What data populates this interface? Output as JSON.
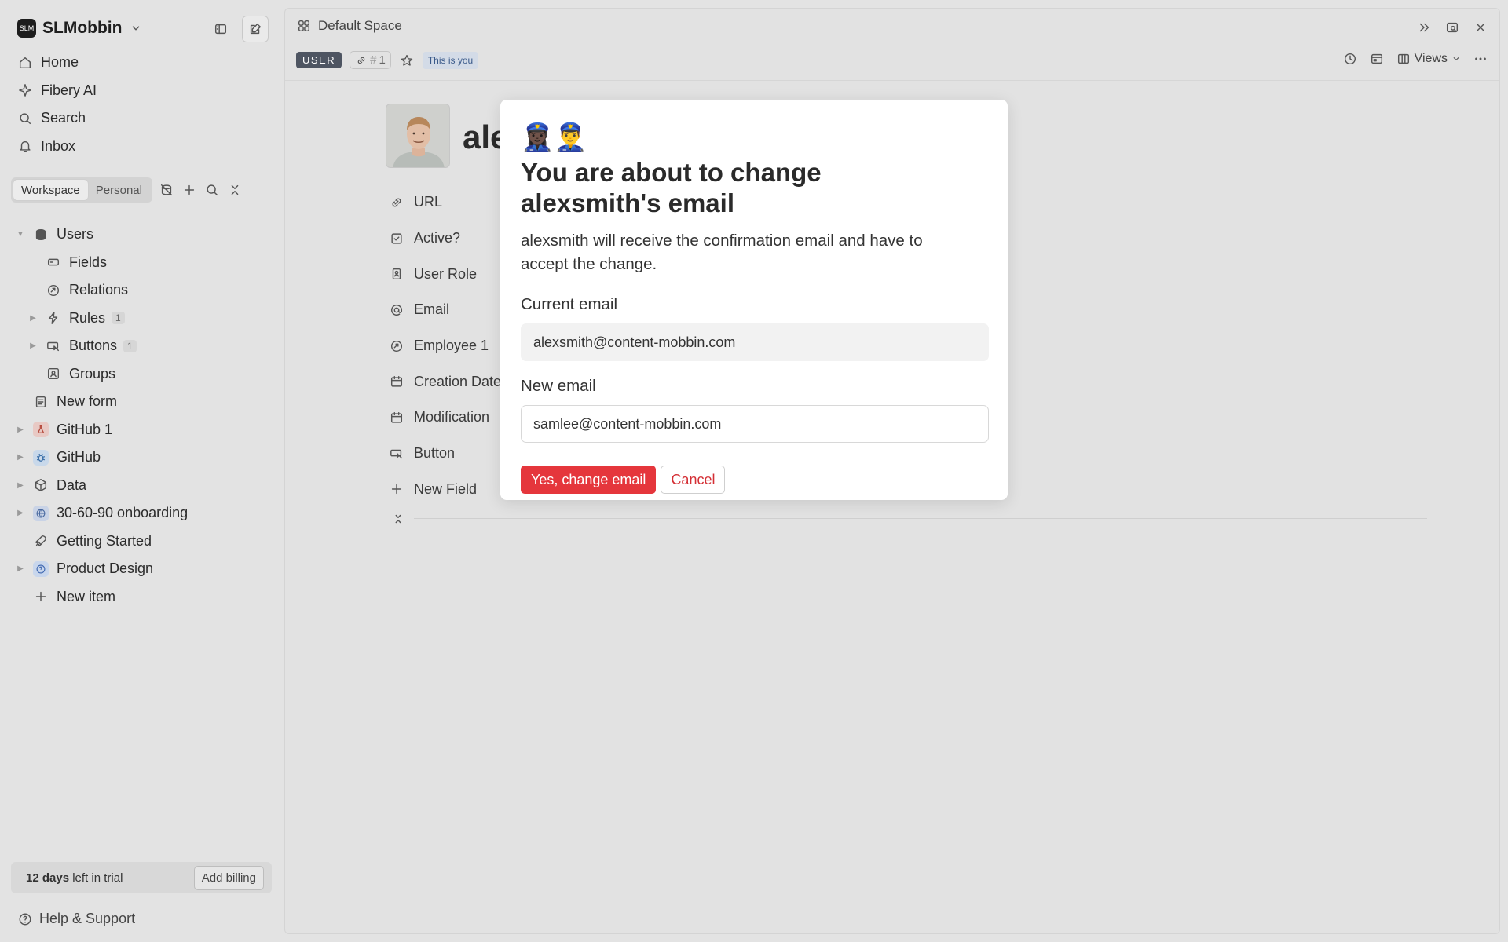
{
  "workspace": {
    "name": "SLMobbin",
    "logo_text": "SLM"
  },
  "nav": [
    {
      "label": "Home",
      "icon": "home-icon"
    },
    {
      "label": "Fibery AI",
      "icon": "sparkle-icon"
    },
    {
      "label": "Search",
      "icon": "search-icon"
    },
    {
      "label": "Inbox",
      "icon": "bell-icon"
    }
  ],
  "space_tabs": {
    "workspace": "Workspace",
    "personal": "Personal"
  },
  "tree": [
    {
      "label": "Users",
      "icon": "database-icon"
    },
    {
      "label": "Fields",
      "icon": "fields-icon"
    },
    {
      "label": "Relations",
      "icon": "relation-icon"
    },
    {
      "label": "Rules",
      "icon": "bolt-icon",
      "count": "1"
    },
    {
      "label": "Buttons",
      "icon": "cursor-button-icon",
      "count": "1"
    },
    {
      "label": "Groups",
      "icon": "group-icon"
    },
    {
      "label": "New form",
      "icon": "form-icon"
    },
    {
      "label": "GitHub 1",
      "icon": "flask-icon"
    },
    {
      "label": "GitHub",
      "icon": "bug-icon"
    },
    {
      "label": "Data",
      "icon": "cube-icon"
    },
    {
      "label": "30-60-90 onboarding",
      "icon": "globe-icon"
    },
    {
      "label": "Getting Started",
      "icon": "rocket-icon"
    },
    {
      "label": "Product Design",
      "icon": "question-icon"
    },
    {
      "label": "New item",
      "icon": "plus-icon"
    }
  ],
  "trial": {
    "days": "12 days",
    "rest": " left in trial",
    "billing_button": "Add billing"
  },
  "help": "Help & Support",
  "main": {
    "breadcrumb": "Default Space",
    "type_tag": "USER",
    "id_tag": "1",
    "you_tag": "This is you",
    "views_label": "Views",
    "title_partial": "ale",
    "fields": [
      {
        "label": "URL",
        "icon": "link-icon"
      },
      {
        "label": "Active?",
        "icon": "checkbox-icon"
      },
      {
        "label": "User Role",
        "icon": "badge-icon"
      },
      {
        "label": "Email",
        "icon": "at-icon"
      },
      {
        "label": "Employee 1",
        "icon": "relation-icon"
      },
      {
        "label": "Creation Date",
        "icon": "calendar-icon"
      },
      {
        "label": "Modification",
        "icon": "calendar-icon"
      },
      {
        "label": "Button",
        "icon": "cursor-button-icon"
      },
      {
        "label": "New Field",
        "icon": "plus-icon"
      }
    ]
  },
  "dialog": {
    "emoji": "👮🏿‍♀️👮‍♂️",
    "title": "You are about to change alexsmith's email",
    "body": "alexsmith will receive the confirmation email and have to accept the change.",
    "current_label": "Current email",
    "current_value": "alexsmith@content-mobbin.com",
    "new_label": "New email",
    "new_value": "samlee@content-mobbin.com",
    "confirm_button": "Yes, change email",
    "cancel_button": "Cancel"
  },
  "colors": {
    "danger": "#e5363c",
    "user_tag": "#4e5562",
    "you_tag_bg": "#d3dbe7"
  }
}
